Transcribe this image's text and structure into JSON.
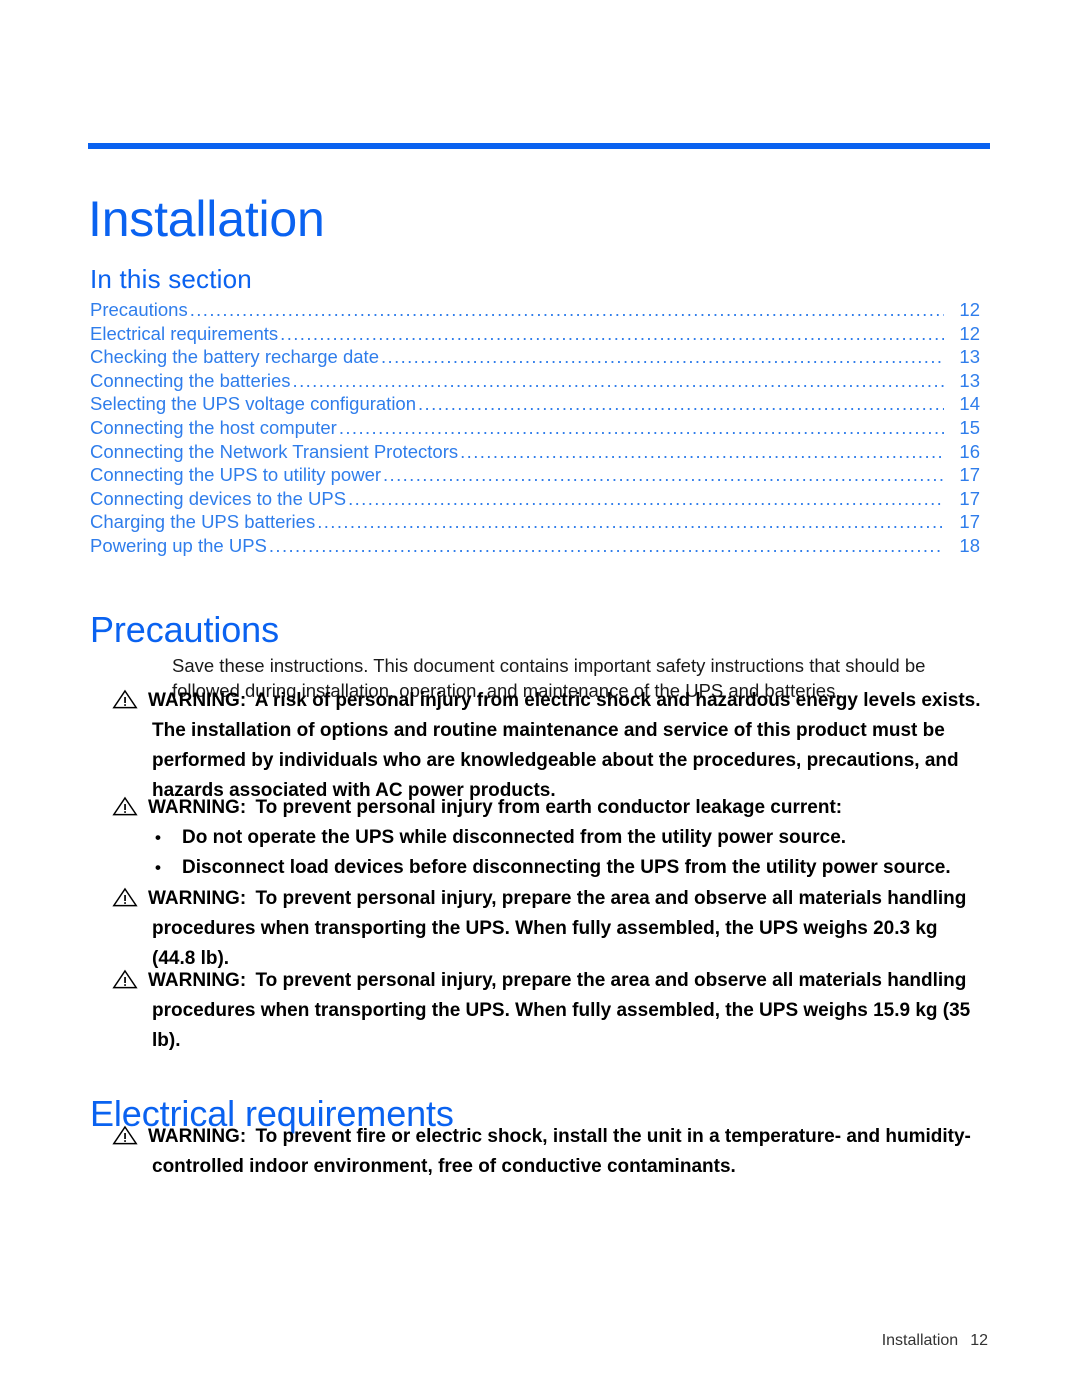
{
  "theme": {
    "accent_blue": "#0A62F0",
    "toc_blue": "#2F7DEB",
    "body_black": "#1a1a1a"
  },
  "header": {
    "chapter_title": "Installation"
  },
  "section_list": {
    "label": "In this section",
    "entries": [
      {
        "title": "Precautions",
        "page": "12"
      },
      {
        "title": "Electrical requirements",
        "page": "12"
      },
      {
        "title": "Checking the battery recharge date",
        "page": "13"
      },
      {
        "title": "Connecting the batteries",
        "page": "13"
      },
      {
        "title": "Selecting the UPS voltage configuration",
        "page": "14"
      },
      {
        "title": "Connecting the host computer",
        "page": "15"
      },
      {
        "title": "Connecting the Network Transient Protectors",
        "page": "16"
      },
      {
        "title": "Connecting the UPS to utility power",
        "page": "17"
      },
      {
        "title": "Connecting devices to the UPS",
        "page": "17"
      },
      {
        "title": "Charging the UPS batteries",
        "page": "17"
      },
      {
        "title": "Powering up the UPS",
        "page": "18"
      }
    ],
    "leader": "..............................................................................................................................................................................................."
  },
  "precautions": {
    "heading": "Precautions",
    "intro": "Save these instructions. This document contains important safety instructions that should be followed during installation, operation, and maintenance of the UPS and batteries.",
    "warning_kicker": "WARNING:",
    "warning_1": "A risk of personal injury from electric shock and hazardous energy levels exists. The installation of options and routine maintenance and service of this product must be performed by individuals who are knowledgeable about the procedures, precautions, and hazards associated with AC power products.",
    "warning_2": "To prevent personal injury from earth conductor leakage current:",
    "warning_2_bullets": [
      "Do not operate the UPS while disconnected from the utility power source.",
      "Disconnect load devices before disconnecting the UPS from the utility power source."
    ],
    "warning_3": "To prevent personal injury, prepare the area and observe all materials handling procedures when transporting the UPS. When fully assembled, the UPS weighs 20.3 kg (44.8 lb).",
    "warning_4": "To prevent personal injury, prepare the area and observe all materials handling procedures when transporting the UPS. When fully assembled, the UPS weighs 15.9 kg (35 lb)."
  },
  "electrical": {
    "heading": "Electrical requirements",
    "warning_kicker": "WARNING:",
    "warning_1": "To prevent fire or electric shock, install the unit in a temperature- and humidity-controlled indoor environment, free of conductive contaminants."
  },
  "footer": {
    "chapter": "Installation",
    "page_number": "12"
  }
}
